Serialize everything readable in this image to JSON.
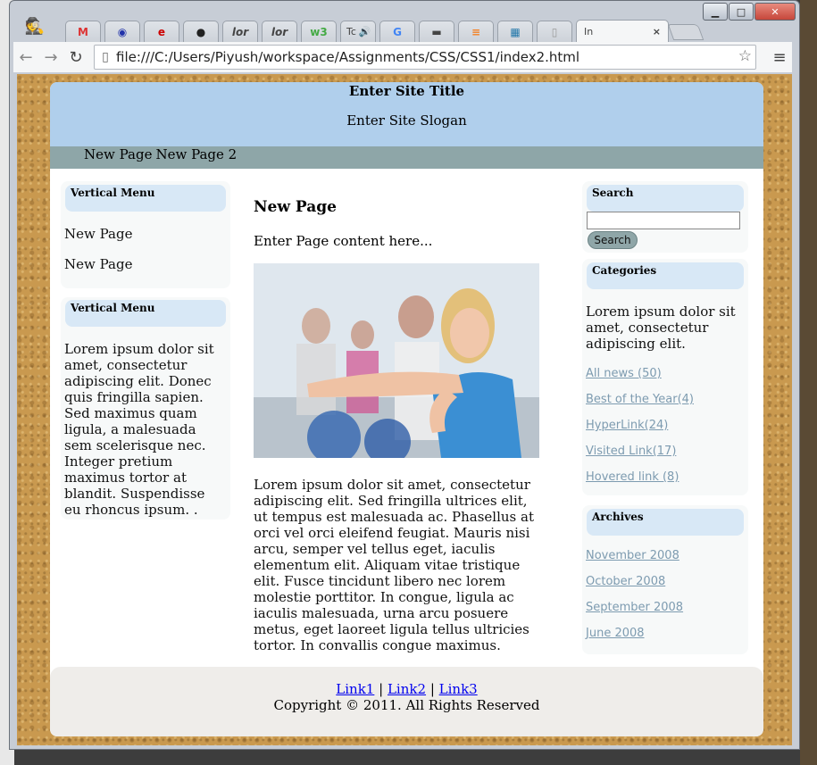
{
  "browser": {
    "tabs": [
      "Tc",
      "In"
    ],
    "tab_close": "×",
    "url": "file:///C:/Users/Piyush/workspace/Assignments/CSS/CSS1/index2.html"
  },
  "site": {
    "title": "Enter Site Title",
    "slogan": "Enter Site Slogan",
    "nav": [
      "New Page",
      "New Page 2"
    ]
  },
  "left_sidebar": {
    "menu1": {
      "heading": "Vertical Menu",
      "items": [
        "New Page",
        "New Page"
      ]
    },
    "menu2": {
      "heading": "Vertical Menu",
      "text": "Lorem ipsum dolor sit amet, consectetur adipiscing elit. Donec quis fringilla sapien. Sed maximus quam ligula, a malesuada sem scelerisque nec. Integer pretium maximus tortor at blandit. Suspendisse eu rhoncus ipsum. ."
    }
  },
  "content": {
    "title": "New Page",
    "intro": "Enter Page content here...",
    "body": "Lorem ipsum dolor sit amet, consectetur adipiscing elit. Sed fringilla ultrices elit, ut tempus est malesuada ac. Phasellus at orci vel orci eleifend feugiat. Mauris nisi arcu, semper vel tellus eget, iaculis elementum elit. Aliquam vitae tristique elit. Fusce tincidunt libero nec lorem molestie porttitor. In congue, ligula ac iaculis malesuada, urna arcu posuere metus, eget laoreet ligula tellus ultricies tortor. In convallis congue maximus."
  },
  "right_sidebar": {
    "search": {
      "heading": "Search",
      "value": "",
      "button": "Search"
    },
    "categories": {
      "heading": "Categories",
      "text": "Lorem ipsum dolor sit amet, consectetur adipiscing elit.",
      "links": [
        "All news (50)",
        "Best of the Year(4)",
        "HyperLink(24)",
        "Visited Link(17)",
        "Hovered link (8)"
      ]
    },
    "archives": {
      "heading": "Archives",
      "links": [
        "November 2008",
        "October 2008",
        "September 2008",
        "June 2008"
      ]
    }
  },
  "footer": {
    "links": [
      "Link1",
      "Link2",
      "Link3"
    ],
    "separator": "|",
    "copyright": "Copyright © 2011. All Rights Reserved"
  }
}
